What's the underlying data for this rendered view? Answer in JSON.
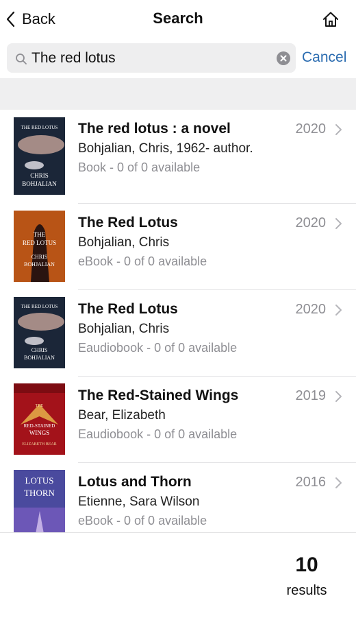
{
  "nav": {
    "back_label": "Back",
    "title": "Search",
    "home_icon": "home-icon"
  },
  "search": {
    "query": "The red lotus",
    "cancel_label": "Cancel",
    "search_icon": "magnifier-icon",
    "clear_icon": "clear-circle-icon"
  },
  "results": [
    {
      "title": "The red lotus : a novel",
      "author": "Bohjalian, Chris, 1962- author.",
      "format": "Book - 0 of 0 available",
      "year": "2020",
      "cover_text": [
        "THE RED LOTUS",
        "CHRIS",
        "BOHJALIAN"
      ]
    },
    {
      "title": "The Red Lotus",
      "author": "Bohjalian, Chris",
      "format": "eBook - 0 of 0 available",
      "year": "2020",
      "cover_text": [
        "THE",
        "RED LOTUS",
        "CHRIS",
        "BOHJALIAN"
      ]
    },
    {
      "title": "The Red Lotus",
      "author": "Bohjalian, Chris",
      "format": "Eaudiobook - 0 of 0 available",
      "year": "2020",
      "cover_text": [
        "THE RED LOTUS",
        "CHRIS",
        "BOHJALIAN"
      ]
    },
    {
      "title": "The Red-Stained Wings",
      "author": "Bear, Elizabeth",
      "format": "Eaudiobook - 0 of 0 available",
      "year": "2019",
      "cover_text": [
        "THE",
        "RED-STAINED",
        "WINGS",
        "ELIZABETH BEAR"
      ]
    },
    {
      "title": "Lotus and Thorn",
      "author": "Etienne, Sara Wilson",
      "format": "eBook - 0 of 0 available",
      "year": "2016",
      "cover_text": [
        "LOTUS",
        "THORN"
      ]
    }
  ],
  "footer": {
    "count": "10",
    "label": "results"
  },
  "colors": {
    "accent": "#2b6cb0",
    "band": "#efeff0",
    "muted": "#8e8e93"
  }
}
